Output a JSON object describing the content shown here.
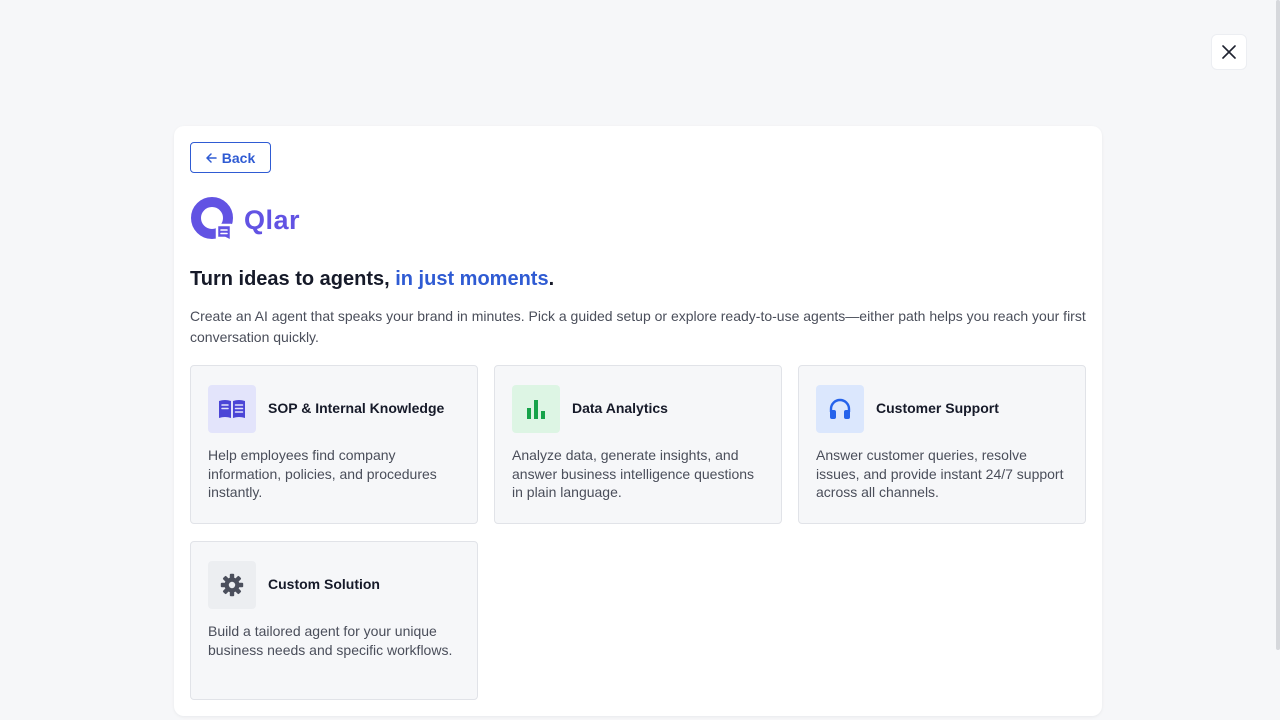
{
  "close_label": "Close",
  "back_label": "Back",
  "brand": {
    "name": "Qlar",
    "color": "#6253e3"
  },
  "headline": {
    "part1": "Turn ideas to agents, ",
    "accent": "in just moments",
    "end": "."
  },
  "description": "Create an AI agent that speaks your brand in minutes. Pick a guided setup or explore ready-to-use agents—either path helps you reach your first conversation quickly.",
  "cards": [
    {
      "title": "SOP & Internal Knowledge",
      "description": "Help employees find company information, policies, and procedures instantly.",
      "icon": "book-icon",
      "icon_color": "#4b45d6",
      "icon_bg": "#e3e4fb"
    },
    {
      "title": "Data Analytics",
      "description": "Analyze data, generate insights, and answer business intelligence questions in plain language.",
      "icon": "bar-chart-icon",
      "icon_color": "#16a34a",
      "icon_bg": "#ddf5e4"
    },
    {
      "title": "Customer Support",
      "description": "Answer customer queries, resolve issues, and provide instant 24/7 support across all channels.",
      "icon": "headphones-icon",
      "icon_color": "#2563eb",
      "icon_bg": "#dbe7fd"
    },
    {
      "title": "Custom Solution",
      "description": "Build a tailored agent for your unique business needs and specific workflows.",
      "icon": "gear-icon",
      "icon_color": "#4b4f5c",
      "icon_bg": "#eceef1"
    }
  ],
  "accent_color": "#2f5bd3"
}
